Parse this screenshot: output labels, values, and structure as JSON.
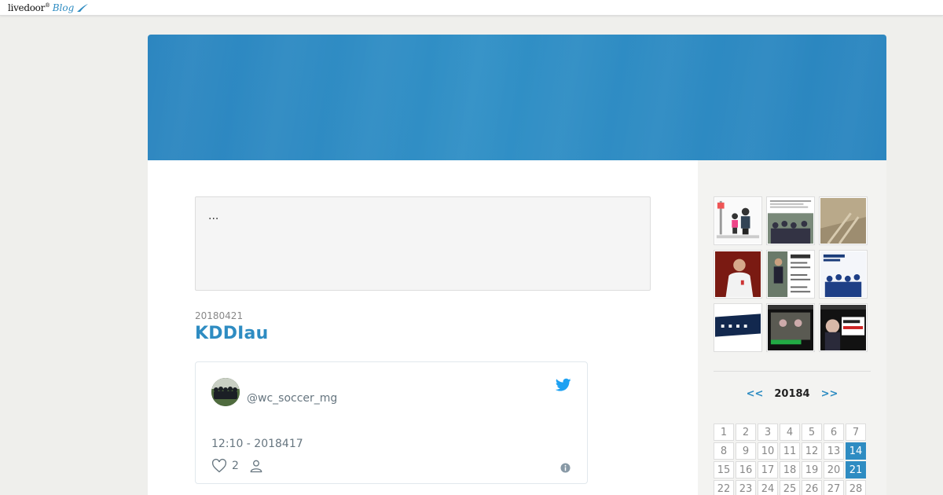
{
  "topbar": {
    "logo_text": "livedoor",
    "logo_sup": "®",
    "logo_blog": "Blog"
  },
  "notice": {
    "text": "..."
  },
  "post": {
    "date": "20180421",
    "title": "KDDIau"
  },
  "tweet": {
    "handle": "@wc_soccer_mg",
    "time": "12:10 - 2018417",
    "likes": "2"
  },
  "sidebar": {
    "thumbnails_count": 9,
    "calendar": {
      "prev": "<<",
      "title": "20184",
      "next": ">>",
      "days": [
        "1",
        "2",
        "3",
        "4",
        "5",
        "6",
        "7",
        "8",
        "9",
        "10",
        "11",
        "12",
        "13",
        "14",
        "15",
        "16",
        "17",
        "18",
        "19",
        "20",
        "21",
        "22",
        "23",
        "24",
        "25",
        "26",
        "27",
        "28"
      ],
      "active_days": [
        "14",
        "21"
      ]
    }
  },
  "colors": {
    "accent": "#2e8cc2",
    "header": "#2c86c0",
    "twitter": "#1da1f2"
  }
}
